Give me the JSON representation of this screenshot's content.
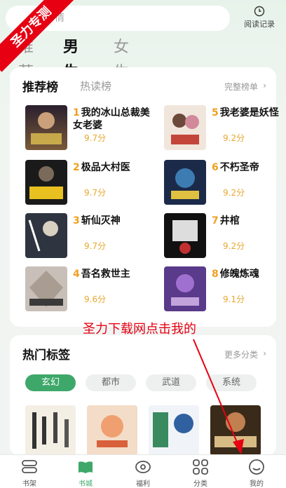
{
  "search": {
    "placeholder": "情"
  },
  "history": {
    "label": "阅读记录",
    "icon": "clock-icon"
  },
  "ribbon": {
    "text": "圣力专测"
  },
  "channels": [
    {
      "label": "推荐",
      "active": false
    },
    {
      "label": "男生",
      "active": true
    },
    {
      "label": "女生",
      "active": false
    }
  ],
  "ranking": {
    "title": "推荐榜",
    "subtitle": "热读榜",
    "more_label": "完整榜单",
    "books": [
      {
        "rank": "1",
        "title": "我的冰山总裁美女老婆",
        "score": "9.7分"
      },
      {
        "rank": "5",
        "title": "我老婆是妖怪",
        "score": "9.2分"
      },
      {
        "rank": "2",
        "title": "极品大村医",
        "score": "9.7分"
      },
      {
        "rank": "6",
        "title": "不朽圣帝",
        "score": "9.2分"
      },
      {
        "rank": "3",
        "title": "斩仙灭神",
        "score": "9.7分"
      },
      {
        "rank": "7",
        "title": "井棺",
        "score": "9.2分"
      },
      {
        "rank": "4",
        "title": "吾名救世主",
        "score": "9.6分"
      },
      {
        "rank": "8",
        "title": "修魄炼魂",
        "score": "9.1分"
      }
    ]
  },
  "hot_tags": {
    "title": "热门标签",
    "more_label": "更多分类",
    "tags": [
      {
        "label": "玄幻",
        "active": true
      },
      {
        "label": "都市",
        "active": false
      },
      {
        "label": "武道",
        "active": false
      },
      {
        "label": "系统",
        "active": false
      }
    ]
  },
  "promo": {
    "text": "圣力下载网点击我的"
  },
  "nav": [
    {
      "label": "书架",
      "icon": "bookshelf-icon",
      "active": false
    },
    {
      "label": "书城",
      "icon": "book-open-icon",
      "active": true
    },
    {
      "label": "福利",
      "icon": "eye-icon",
      "active": false
    },
    {
      "label": "分类",
      "icon": "grid-icon",
      "active": false
    },
    {
      "label": "我的",
      "icon": "smiley-icon",
      "active": false
    }
  ],
  "colors": {
    "accent": "#3ea86a",
    "score": "#e7a82e",
    "ribbon": "#e60012"
  }
}
